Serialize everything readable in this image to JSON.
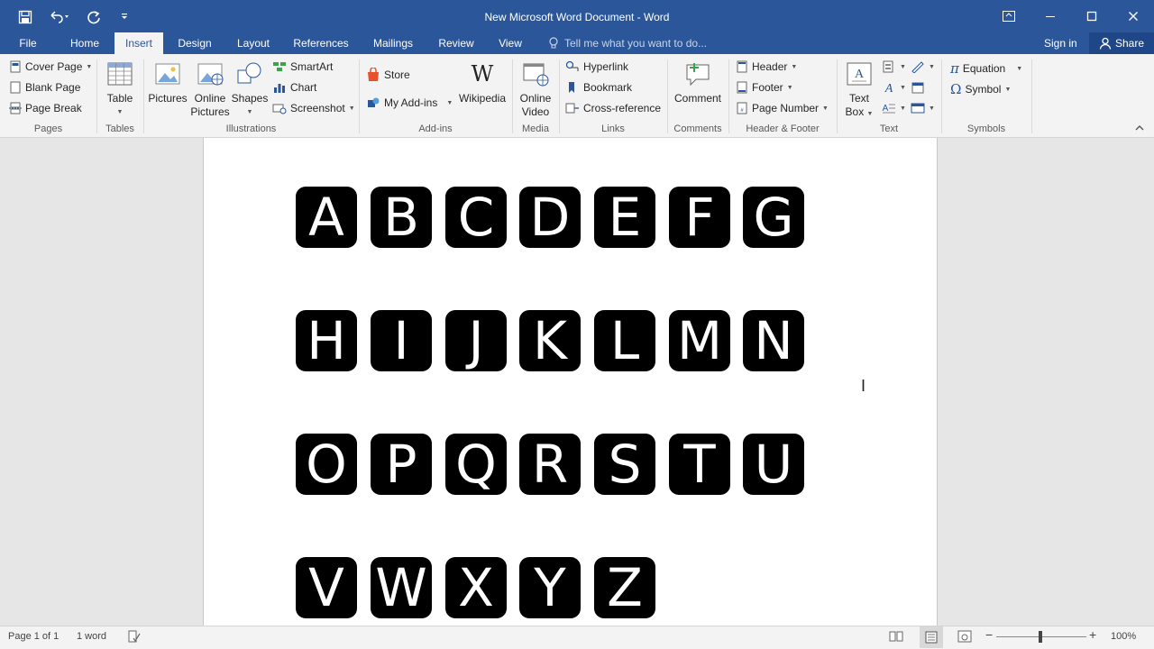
{
  "window": {
    "title": "New Microsoft Word Document - Word",
    "accent": "#2b579a"
  },
  "tabs": [
    {
      "label": "File"
    },
    {
      "label": "Home"
    },
    {
      "label": "Insert"
    },
    {
      "label": "Design"
    },
    {
      "label": "Layout"
    },
    {
      "label": "References"
    },
    {
      "label": "Mailings"
    },
    {
      "label": "Review"
    },
    {
      "label": "View"
    }
  ],
  "active_tab": "Insert",
  "tellme": {
    "placeholder": "Tell me what you want to do..."
  },
  "account": {
    "signin": "Sign in",
    "share": "Share"
  },
  "ribbon": {
    "pages": {
      "label": "Pages",
      "cover_page": "Cover Page",
      "blank_page": "Blank Page",
      "page_break": "Page Break"
    },
    "tables": {
      "label": "Tables",
      "table": "Table"
    },
    "illustrations": {
      "label": "Illustrations",
      "pictures": "Pictures",
      "online_pictures_1": "Online",
      "online_pictures_2": "Pictures",
      "shapes": "Shapes",
      "smartart": "SmartArt",
      "chart": "Chart",
      "screenshot": "Screenshot"
    },
    "addins": {
      "label": "Add-ins",
      "store": "Store",
      "my_addins": "My Add-ins",
      "wikipedia": "Wikipedia"
    },
    "media": {
      "label": "Media",
      "online_video_1": "Online",
      "online_video_2": "Video"
    },
    "links": {
      "label": "Links",
      "hyperlink": "Hyperlink",
      "bookmark": "Bookmark",
      "cross_reference": "Cross-reference"
    },
    "comments": {
      "label": "Comments",
      "comment": "Comment"
    },
    "header_footer": {
      "label": "Header & Footer",
      "header": "Header",
      "footer": "Footer",
      "page_number": "Page Number"
    },
    "text": {
      "label": "Text",
      "text_box_1": "Text",
      "text_box_2": "Box"
    },
    "symbols": {
      "label": "Symbols",
      "equation": "Equation",
      "symbol": "Symbol"
    }
  },
  "document": {
    "rows": [
      [
        "A",
        "B",
        "C",
        "D",
        "E",
        "F",
        "G"
      ],
      [
        "H",
        "I",
        "J",
        "K",
        "L",
        "M",
        "N"
      ],
      [
        "O",
        "P",
        "Q",
        "R",
        "S",
        "T",
        "U"
      ],
      [
        "V",
        "W",
        "X",
        "Y",
        "Z"
      ]
    ]
  },
  "status": {
    "page": "Page 1 of 1",
    "words": "1 word",
    "zoom": "100%"
  }
}
